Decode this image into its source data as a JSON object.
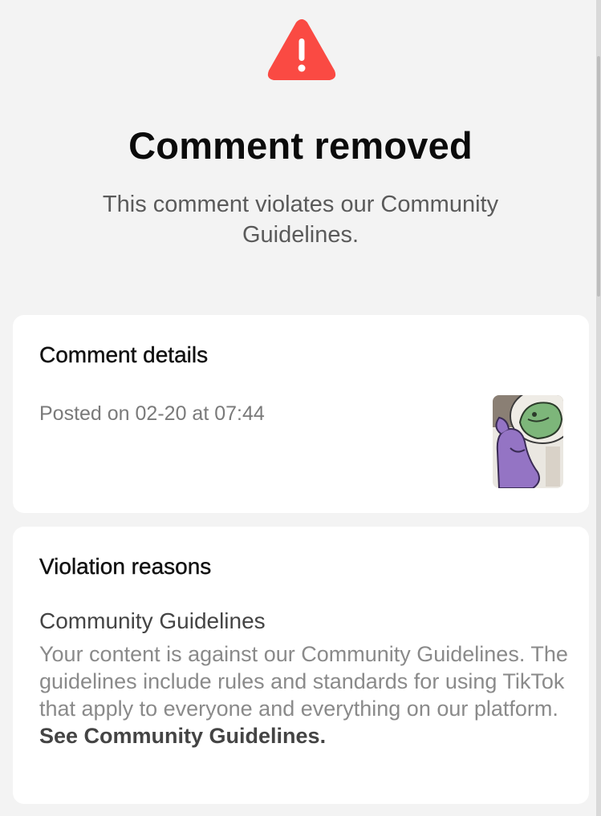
{
  "header": {
    "icon": "warning-triangle-icon",
    "title": "Comment removed",
    "subtitle": "This comment violates our Community Guidelines."
  },
  "comment_details": {
    "heading": "Comment details",
    "posted": "Posted on 02-20 at 07:44",
    "thumbnail": "video-thumbnail-cartoon"
  },
  "violation": {
    "heading": "Violation reasons",
    "reason_title": "Community Guidelines",
    "reason_body": "Your content is against our Community Guidelines. The guidelines include rules and standards for using TikTok that apply to everyone and everything on our platform. ",
    "link_label": "See Community Guidelines."
  },
  "colors": {
    "warning": "#fa4a43",
    "background": "#f3f3f3",
    "card": "#ffffff",
    "muted_text": "#8a8a8a"
  }
}
